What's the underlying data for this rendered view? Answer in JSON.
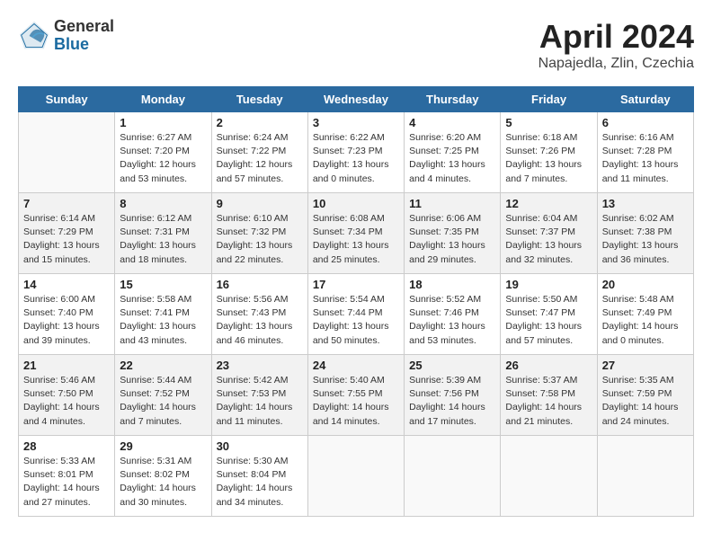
{
  "header": {
    "logo_general": "General",
    "logo_blue": "Blue",
    "month_year": "April 2024",
    "location": "Napajedla, Zlin, Czechia"
  },
  "days_of_week": [
    "Sunday",
    "Monday",
    "Tuesday",
    "Wednesday",
    "Thursday",
    "Friday",
    "Saturday"
  ],
  "weeks": [
    [
      {
        "day": "",
        "info": ""
      },
      {
        "day": "1",
        "info": "Sunrise: 6:27 AM\nSunset: 7:20 PM\nDaylight: 12 hours\nand 53 minutes."
      },
      {
        "day": "2",
        "info": "Sunrise: 6:24 AM\nSunset: 7:22 PM\nDaylight: 12 hours\nand 57 minutes."
      },
      {
        "day": "3",
        "info": "Sunrise: 6:22 AM\nSunset: 7:23 PM\nDaylight: 13 hours\nand 0 minutes."
      },
      {
        "day": "4",
        "info": "Sunrise: 6:20 AM\nSunset: 7:25 PM\nDaylight: 13 hours\nand 4 minutes."
      },
      {
        "day": "5",
        "info": "Sunrise: 6:18 AM\nSunset: 7:26 PM\nDaylight: 13 hours\nand 7 minutes."
      },
      {
        "day": "6",
        "info": "Sunrise: 6:16 AM\nSunset: 7:28 PM\nDaylight: 13 hours\nand 11 minutes."
      }
    ],
    [
      {
        "day": "7",
        "info": "Sunrise: 6:14 AM\nSunset: 7:29 PM\nDaylight: 13 hours\nand 15 minutes."
      },
      {
        "day": "8",
        "info": "Sunrise: 6:12 AM\nSunset: 7:31 PM\nDaylight: 13 hours\nand 18 minutes."
      },
      {
        "day": "9",
        "info": "Sunrise: 6:10 AM\nSunset: 7:32 PM\nDaylight: 13 hours\nand 22 minutes."
      },
      {
        "day": "10",
        "info": "Sunrise: 6:08 AM\nSunset: 7:34 PM\nDaylight: 13 hours\nand 25 minutes."
      },
      {
        "day": "11",
        "info": "Sunrise: 6:06 AM\nSunset: 7:35 PM\nDaylight: 13 hours\nand 29 minutes."
      },
      {
        "day": "12",
        "info": "Sunrise: 6:04 AM\nSunset: 7:37 PM\nDaylight: 13 hours\nand 32 minutes."
      },
      {
        "day": "13",
        "info": "Sunrise: 6:02 AM\nSunset: 7:38 PM\nDaylight: 13 hours\nand 36 minutes."
      }
    ],
    [
      {
        "day": "14",
        "info": "Sunrise: 6:00 AM\nSunset: 7:40 PM\nDaylight: 13 hours\nand 39 minutes."
      },
      {
        "day": "15",
        "info": "Sunrise: 5:58 AM\nSunset: 7:41 PM\nDaylight: 13 hours\nand 43 minutes."
      },
      {
        "day": "16",
        "info": "Sunrise: 5:56 AM\nSunset: 7:43 PM\nDaylight: 13 hours\nand 46 minutes."
      },
      {
        "day": "17",
        "info": "Sunrise: 5:54 AM\nSunset: 7:44 PM\nDaylight: 13 hours\nand 50 minutes."
      },
      {
        "day": "18",
        "info": "Sunrise: 5:52 AM\nSunset: 7:46 PM\nDaylight: 13 hours\nand 53 minutes."
      },
      {
        "day": "19",
        "info": "Sunrise: 5:50 AM\nSunset: 7:47 PM\nDaylight: 13 hours\nand 57 minutes."
      },
      {
        "day": "20",
        "info": "Sunrise: 5:48 AM\nSunset: 7:49 PM\nDaylight: 14 hours\nand 0 minutes."
      }
    ],
    [
      {
        "day": "21",
        "info": "Sunrise: 5:46 AM\nSunset: 7:50 PM\nDaylight: 14 hours\nand 4 minutes."
      },
      {
        "day": "22",
        "info": "Sunrise: 5:44 AM\nSunset: 7:52 PM\nDaylight: 14 hours\nand 7 minutes."
      },
      {
        "day": "23",
        "info": "Sunrise: 5:42 AM\nSunset: 7:53 PM\nDaylight: 14 hours\nand 11 minutes."
      },
      {
        "day": "24",
        "info": "Sunrise: 5:40 AM\nSunset: 7:55 PM\nDaylight: 14 hours\nand 14 minutes."
      },
      {
        "day": "25",
        "info": "Sunrise: 5:39 AM\nSunset: 7:56 PM\nDaylight: 14 hours\nand 17 minutes."
      },
      {
        "day": "26",
        "info": "Sunrise: 5:37 AM\nSunset: 7:58 PM\nDaylight: 14 hours\nand 21 minutes."
      },
      {
        "day": "27",
        "info": "Sunrise: 5:35 AM\nSunset: 7:59 PM\nDaylight: 14 hours\nand 24 minutes."
      }
    ],
    [
      {
        "day": "28",
        "info": "Sunrise: 5:33 AM\nSunset: 8:01 PM\nDaylight: 14 hours\nand 27 minutes."
      },
      {
        "day": "29",
        "info": "Sunrise: 5:31 AM\nSunset: 8:02 PM\nDaylight: 14 hours\nand 30 minutes."
      },
      {
        "day": "30",
        "info": "Sunrise: 5:30 AM\nSunset: 8:04 PM\nDaylight: 14 hours\nand 34 minutes."
      },
      {
        "day": "",
        "info": ""
      },
      {
        "day": "",
        "info": ""
      },
      {
        "day": "",
        "info": ""
      },
      {
        "day": "",
        "info": ""
      }
    ]
  ]
}
